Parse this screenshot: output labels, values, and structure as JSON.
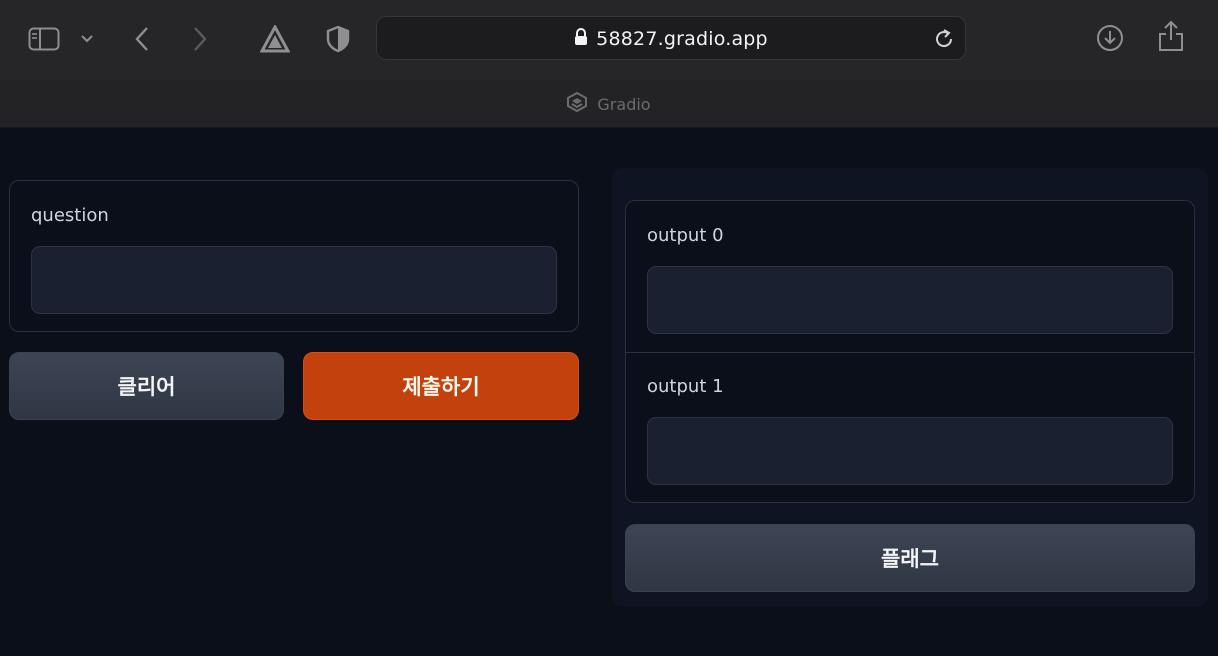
{
  "browser": {
    "url": "58827.gradio.app",
    "tab_title": "Gradio",
    "icons": [
      "sidebar-icon",
      "chevron-down-icon",
      "back-icon",
      "forward-icon",
      "extension-icon",
      "shield-icon",
      "lock-icon",
      "reload-icon",
      "download-icon",
      "share-icon",
      "gradio-logo-icon"
    ]
  },
  "inputs": {
    "question_label": "question",
    "question_value": ""
  },
  "actions": {
    "clear_label": "클리어",
    "submit_label": "제출하기",
    "flag_label": "플래그"
  },
  "outputs": {
    "output0_label": "output 0",
    "output0_value": "",
    "output1_label": "output 1",
    "output1_value": ""
  },
  "colors": {
    "primary_button": "#c2410c",
    "background": "#0b0f19"
  }
}
